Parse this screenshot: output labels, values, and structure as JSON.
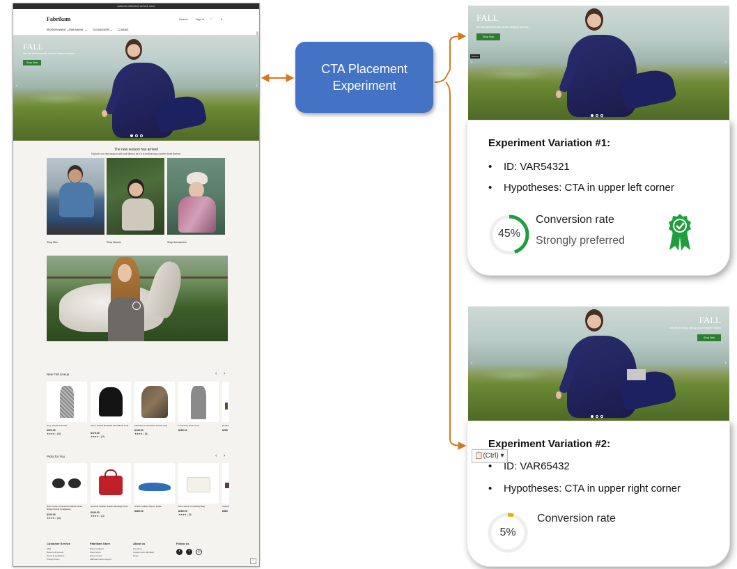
{
  "site": {
    "announcement": "Autumn collection arrives soon",
    "brand": "Fabrikam",
    "nav": [
      "Womenswear ⌄",
      "Menswear ⌄",
      "Accessories ⌄",
      "Contact"
    ],
    "utilities": [
      "Search",
      "Sign in",
      "♡",
      "0"
    ],
    "hero": {
      "title": "FALL",
      "subtitle": "See the fall lineup with all new designer dresses",
      "cta": "Shop Now"
    },
    "season": {
      "title": "The new season has arrived",
      "subtitle": "Explore our new season with soft fabrics as if it is embracing a subtle florist breeze."
    },
    "categories": [
      "Shop Men",
      "Shop Women",
      "Shop Accessories"
    ],
    "new_fall_lineup": {
      "title": "New Fall Lineup",
      "products": [
        {
          "name": "Grey Tweed Overcoat",
          "price": "$320.00",
          "stars": "★★★★☆ (15)"
        },
        {
          "name": "Men's Double Breasted Wool Blend Coat",
          "price": "$175.00",
          "stars": "★★★★☆ (12)"
        },
        {
          "name": "Plaid Men's Oversized Trench Coat",
          "price": "$138.00",
          "stars": "★★★★☆ (8)"
        },
        {
          "name": "Long Grey Dress Coat",
          "price": "$280.00",
          "stars": ""
        },
        {
          "name": "Double",
          "price": "$265",
          "stars": ""
        }
      ]
    },
    "picks_for_you": {
      "title": "Picks for You",
      "products": [
        {
          "name": "Retro Unisex Oversized Fashion Rose Bridge Round Sunglasses",
          "price": "$100.00",
          "stars": "★★★★☆ (16)"
        },
        {
          "name": "Genuine Leather Suede Handbag Purse",
          "price": "$340.00",
          "stars": "★★★★☆ (11)"
        },
        {
          "name": "Suede Leather Slip-on Loafer",
          "price": "$280.00",
          "stars": ""
        },
        {
          "name": "Mini Leather Crossbody Bag",
          "price": "$160.00",
          "stars": "★★★★☆ (9)"
        },
        {
          "name": "Casual",
          "price": "$380",
          "stars": ""
        }
      ]
    },
    "footer": {
      "columns": [
        {
          "heading": "Customer Service",
          "links": [
            "FAQ",
            "Returns & refunds",
            "Terms & conditions",
            "Privacy Policy"
          ]
        },
        {
          "heading": "Fabrikam Store",
          "links": [
            "Store locations",
            "Store hours",
            "Store events",
            "Fabrikam store support"
          ]
        },
        {
          "heading": "About us",
          "links": [
            "Our story",
            "Careers with Fabrikam",
            "News"
          ]
        },
        {
          "heading": "Follow us",
          "links": []
        }
      ],
      "social_icons": [
        "facebook-icon",
        "twitter-icon",
        "instagram-icon"
      ]
    }
  },
  "experiment": {
    "node_label_line1": "CTA Placement",
    "node_label_line2": "Experiment",
    "node_color": "#4472c4",
    "connector_color": "#d47a1c",
    "variations": [
      {
        "hero_title": "FALL",
        "hero_subtitle": "See the fall lineup with all new designer dresses",
        "hero_cta": "Shop Now",
        "badge": "Flowers",
        "title": "Experiment Variation #1:",
        "id_text": "ID: VAR54321",
        "hypothesis_text": "Hypotheses: CTA in upper left corner",
        "rate_label": "Conversion rate",
        "rate_status": "Strongly preferred",
        "conversion_rate": 45,
        "conversion_display": "45%",
        "gauge_color": "#1e9e3e",
        "winner_icon": "award-ribbon-check-icon"
      },
      {
        "hero_title": "FALL",
        "hero_subtitle": "See the fall lineup with all new designer dresses",
        "hero_cta": "Shop Now",
        "title": "Experiment Variation #2:",
        "id_text": "ID: VAR65432",
        "hypothesis_text": "Hypotheses: CTA in upper right corner",
        "rate_label": "Conversion rate",
        "conversion_rate": 5,
        "conversion_display": "5%",
        "gauge_color": "#e0b000",
        "paste_options": "(Ctrl) ▾"
      }
    ]
  }
}
